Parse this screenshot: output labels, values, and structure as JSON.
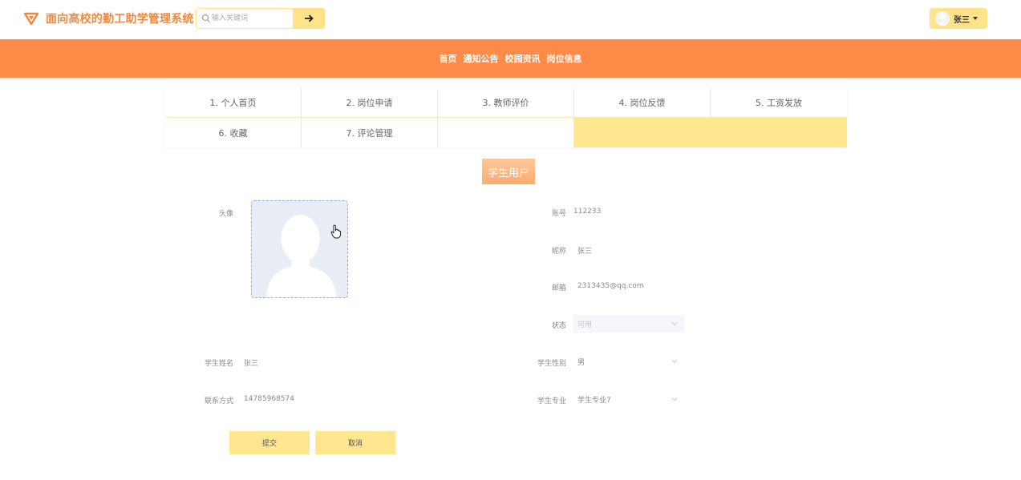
{
  "header": {
    "app_title": "面向高校的勤工助学管理系统",
    "search_placeholder": "输入关键词",
    "user_name": "张三"
  },
  "nav": {
    "items": [
      "首页",
      "通知公告",
      "校园资讯",
      "岗位信息"
    ]
  },
  "tabs": [
    "1. 个人首页",
    "2. 岗位申请",
    "3. 教师评价",
    "4. 岗位反馈",
    "5. 工资发放",
    "6. 收藏",
    "7. 评论管理"
  ],
  "role_badge": "学生用户",
  "form": {
    "avatar_label": "头像",
    "account_label": "账号",
    "account_value": "112233",
    "nickname_label": "昵称",
    "nickname_value": "张三",
    "email_label": "邮箱",
    "email_value": "2313435@qq.com",
    "status_label": "状态",
    "status_value": "可用",
    "student_name_label": "学生姓名",
    "student_name_value": "张三",
    "gender_label": "学生性别",
    "gender_value": "男",
    "contact_label": "联系方式",
    "contact_value": "14785968574",
    "major_label": "学生专业",
    "major_value": "学生专业7",
    "submit_label": "提交",
    "cancel_label": "取消"
  },
  "colors": {
    "brand": "#f0883e",
    "nav_bg": "#ff8b48",
    "accent_yellow": "#ffe68f"
  },
  "icons": {
    "logo": "triangle-logo-icon",
    "search": "search-icon",
    "go": "arrow-right-icon",
    "cursor": "hand-pointer-icon"
  }
}
